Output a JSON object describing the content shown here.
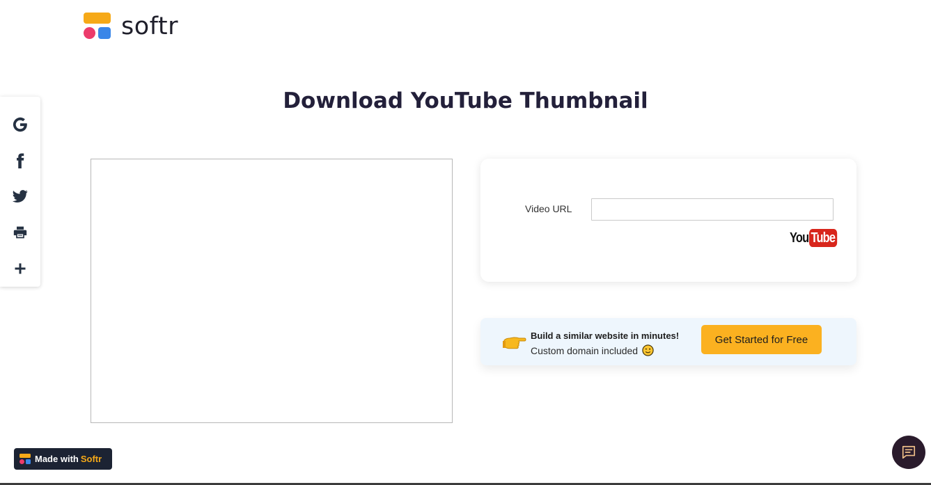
{
  "brand": {
    "name": "softr",
    "colors": {
      "yellow": "#f6a918",
      "pink": "#ec3b6b",
      "blue": "#3a86e8"
    }
  },
  "page": {
    "title": "Download YouTube Thumbnail"
  },
  "share_bar": {
    "items": [
      {
        "icon": "google-icon",
        "label": "Google"
      },
      {
        "icon": "facebook-icon",
        "label": "Facebook"
      },
      {
        "icon": "twitter-icon",
        "label": "Twitter"
      },
      {
        "icon": "print-icon",
        "label": "Print"
      },
      {
        "icon": "plus-icon",
        "label": "More"
      }
    ]
  },
  "form": {
    "video_url_label": "Video URL",
    "video_url_value": "",
    "video_url_placeholder": "",
    "youtube_logo": {
      "you": "You",
      "tube": "Tube"
    }
  },
  "cta": {
    "emoji": "backhand-index-pointing-right",
    "title": "Build a similar website in minutes!",
    "subtitle": "Custom domain included",
    "subtitle_emoji": "winking-face",
    "button_label": "Get Started for Free",
    "button_color": "#fbb120"
  },
  "made_with": {
    "prefix": "Made with",
    "brand": "Softr"
  },
  "chat": {
    "icon": "chat-icon",
    "color": "#2a1b2c"
  }
}
